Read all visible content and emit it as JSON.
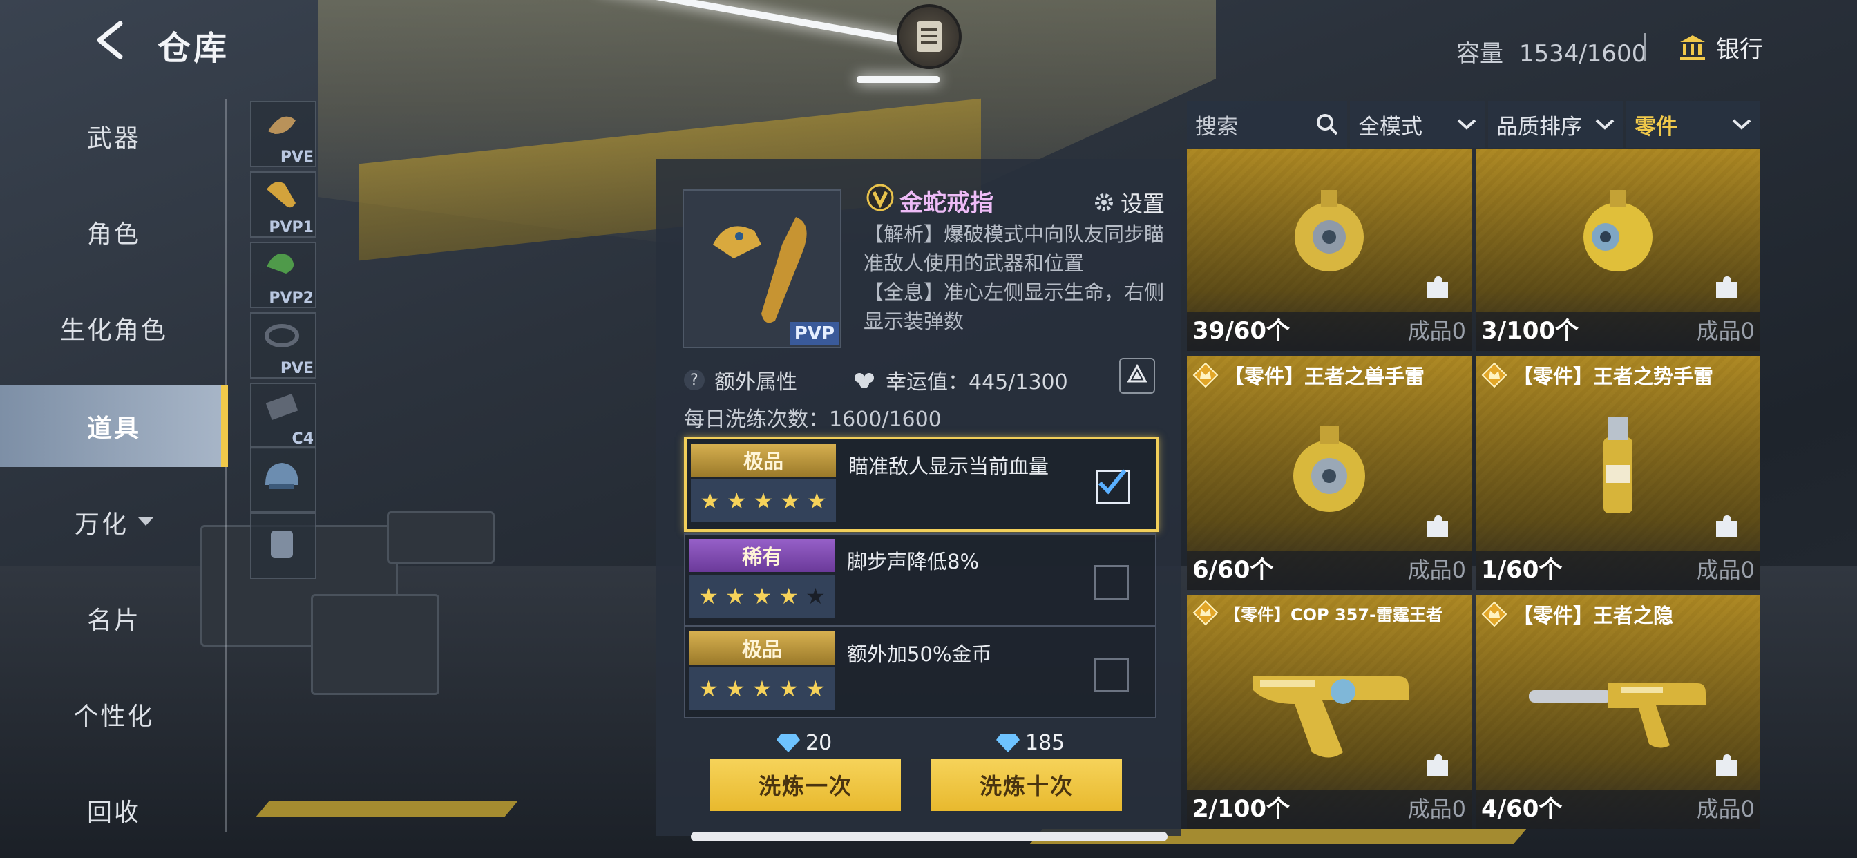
{
  "header": {
    "title": "仓库",
    "capacity_label": "容量",
    "capacity_value": "1534/1600",
    "bank_label": "银行"
  },
  "sidebar": {
    "items": [
      {
        "label": "武器"
      },
      {
        "label": "角色"
      },
      {
        "label": "生化角色"
      },
      {
        "label": "道具",
        "active": true
      },
      {
        "label": "万化"
      },
      {
        "label": "名片"
      },
      {
        "label": "个性化"
      },
      {
        "label": "回收"
      }
    ]
  },
  "subcategories": [
    {
      "tag": "PVE"
    },
    {
      "tag": "PVP1"
    },
    {
      "tag": "PVP2"
    },
    {
      "tag": "PVE"
    },
    {
      "tag": "C4"
    },
    {
      "tag": ""
    },
    {
      "tag": ""
    }
  ],
  "detail": {
    "item_tag": "PVP",
    "name": "金蛇戒指",
    "settings_label": "设置",
    "description": "【解析】爆破模式中向队友同步瞄准敌人使用的武器和位置\n【全息】准心左侧显示生命，右侧显示装弹数",
    "extra_attr_label": "额外属性",
    "luck_label": "幸运值：445/1300",
    "daily_refine": "每日洗练次数：1600/1600",
    "attributes": [
      {
        "grade": "极品",
        "grade_color": "#c9a040",
        "stars": 5,
        "max_stars": 5,
        "text": "瞄准敌人显示当前血量",
        "checked": true
      },
      {
        "grade": "稀有",
        "grade_color": "#8450b8",
        "stars": 4,
        "max_stars": 5,
        "text": "脚步声降低8%",
        "checked": false
      },
      {
        "grade": "极品",
        "grade_color": "#c9a040",
        "stars": 5,
        "max_stars": 5,
        "text": "额外加50%金币",
        "checked": false
      }
    ],
    "cost_once": "20",
    "cost_ten": "185",
    "refine_once_label": "洗炼一次",
    "refine_ten_label": "洗炼十次"
  },
  "filters": {
    "search_placeholder": "搜索",
    "mode": "全模式",
    "sort": "品质排序",
    "category": "零件",
    "category_color": "#f1c94a"
  },
  "cards": [
    {
      "title": "",
      "count": "39/60个",
      "made": "成品0",
      "art": "grenade-icon"
    },
    {
      "title": "",
      "count": "3/100个",
      "made": "成品0",
      "art": "grenade-icon"
    },
    {
      "title": "【零件】王者之兽手雷",
      "count": "6/60个",
      "made": "成品0",
      "art": "grenade-icon"
    },
    {
      "title": "【零件】王者之势手雷",
      "count": "1/60个",
      "made": "成品0",
      "art": "smoke-grenade-icon"
    },
    {
      "title": "【零件】COP 357-雷霆王者",
      "count": "2/100个",
      "made": "成品0",
      "art": "pistol-icon"
    },
    {
      "title": "【零件】王者之隐",
      "count": "4/60个",
      "made": "成品0",
      "art": "silenced-pistol-icon"
    }
  ],
  "colors": {
    "accent": "#f1c94a",
    "gold_card": "#a58324",
    "panel": "#283040"
  }
}
